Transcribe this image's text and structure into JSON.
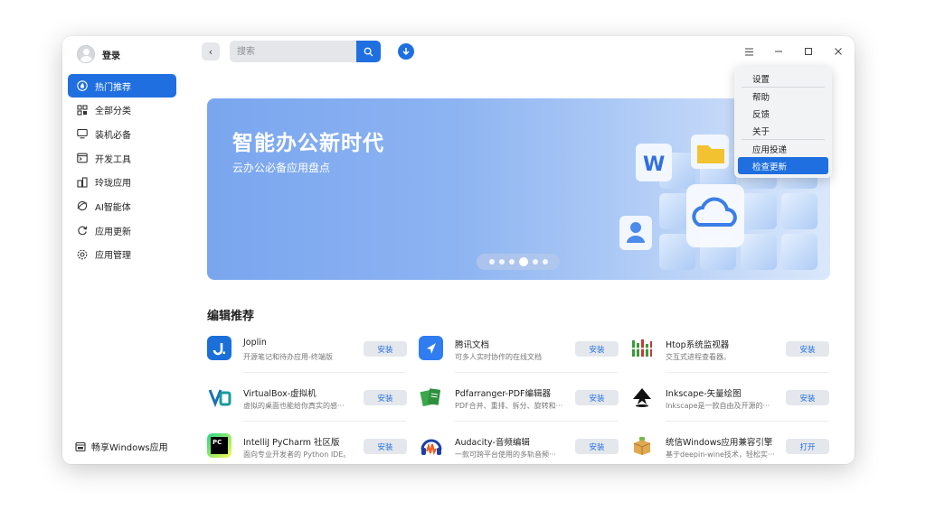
{
  "user": {
    "name": "登录"
  },
  "sidebar": {
    "items": [
      {
        "label": "热门推荐",
        "icon": "flame-icon",
        "active": true
      },
      {
        "label": "全部分类",
        "icon": "grid-icon"
      },
      {
        "label": "装机必备",
        "icon": "monitor-icon"
      },
      {
        "label": "开发工具",
        "icon": "terminal-icon"
      },
      {
        "label": "玲珑应用",
        "icon": "package-icon"
      },
      {
        "label": "AI智能体",
        "icon": "ai-icon"
      },
      {
        "label": "应用更新",
        "icon": "refresh-icon"
      },
      {
        "label": "应用管理",
        "icon": "gear-icon"
      }
    ],
    "share_label": "畅享Windows应用"
  },
  "search": {
    "placeholder": "搜索"
  },
  "menu": {
    "items": [
      "设置",
      "帮助",
      "反馈",
      "关于",
      "应用投递",
      "检查更新"
    ],
    "active": "检查更新"
  },
  "banner": {
    "title": "智能办公新时代",
    "subtitle": "云办公必备应用盘点",
    "slide_count": 6,
    "active_slide": 4
  },
  "section": {
    "title": "编辑推荐"
  },
  "apps": [
    {
      "name": "Joplin",
      "desc": "开源笔记和待办应用-终端版",
      "button": "安装",
      "icon": "joplin-icon"
    },
    {
      "name": "腾讯文档",
      "desc": "可多人实时协作的在线文档",
      "button": "安装",
      "icon": "tencent-docs-icon"
    },
    {
      "name": "Htop系统监视器",
      "desc": "交互式进程查看器。",
      "button": "安装",
      "icon": "htop-icon"
    },
    {
      "name": "VirtualBox-虚拟机",
      "desc": "虚拟的桌面也能给你真实的感···",
      "button": "安装",
      "icon": "virtualbox-icon"
    },
    {
      "name": "Pdfarranger-PDF编辑器",
      "desc": "PDF合并、重排、拆分、旋转和···",
      "button": "安装",
      "icon": "pdfarranger-icon"
    },
    {
      "name": "Inkscape-矢量绘图",
      "desc": "Inkscape是一款自由及开源的···",
      "button": "安装",
      "icon": "inkscape-icon"
    },
    {
      "name": "IntelliJ PyCharm 社区版",
      "desc": "面向专业开发者的 Python IDE。",
      "button": "安装",
      "icon": "pycharm-icon"
    },
    {
      "name": "Audacity-音频编辑",
      "desc": "一款可跨平台使用的多轨音频···",
      "button": "安装",
      "icon": "audacity-icon"
    },
    {
      "name": "统信Windows应用兼容引擎",
      "desc": "基于deepin-wine技术，轻松实···",
      "button": "打开",
      "icon": "wine-engine-icon"
    }
  ],
  "colors": {
    "accent": "#1f6fe0"
  }
}
